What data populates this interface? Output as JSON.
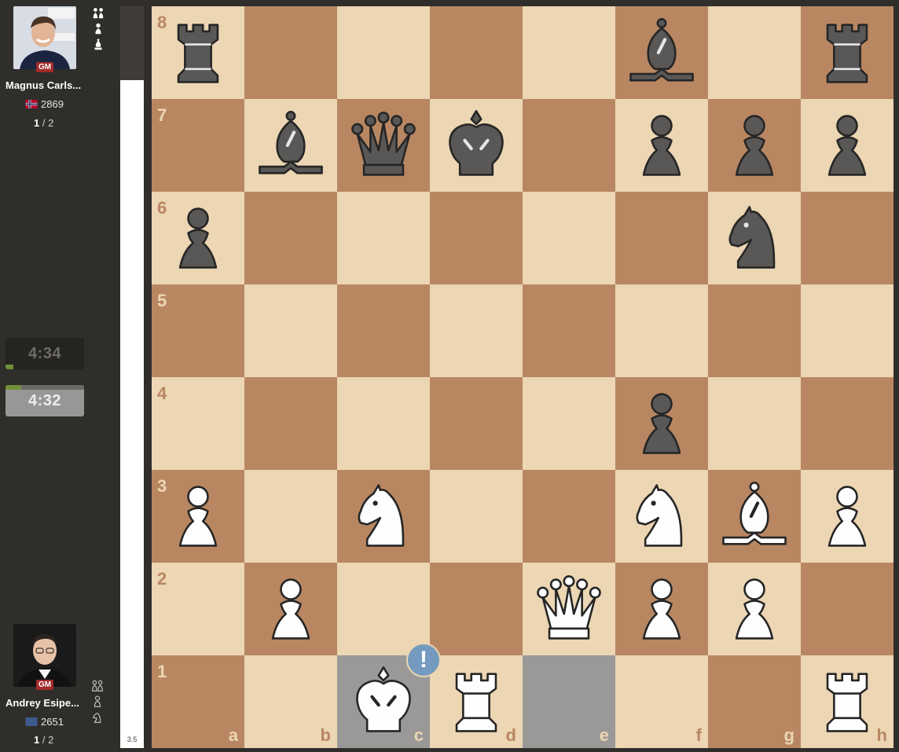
{
  "top_player": {
    "title": "GM",
    "name": "Magnus Carls...",
    "rating": "2869",
    "flag": "norway",
    "score_bold": "1",
    "score_rest": "/ 2",
    "captured_icons": [
      "two-pawns-icon",
      "pawn-icon",
      "bishop-icon"
    ]
  },
  "bottom_player": {
    "title": "GM",
    "name": "Andrey Esipe...",
    "rating": "2651",
    "flag": "blue-flag",
    "score_bold": "1",
    "score_rest": "/ 2",
    "captured_icons": [
      "two-pawns-icon",
      "pawn-icon",
      "knight-icon"
    ]
  },
  "clocks": {
    "black": "4:34",
    "white": "4:32"
  },
  "eval": {
    "text": "3.5",
    "black_fraction": 0.1
  },
  "board": {
    "ranks": [
      "8",
      "7",
      "6",
      "5",
      "4",
      "3",
      "2",
      "1"
    ],
    "files": [
      "a",
      "b",
      "c",
      "d",
      "e",
      "f",
      "g",
      "h"
    ],
    "light_color": "#ecd6b3",
    "dark_color": "#b88762",
    "highlight_squares": [
      "c1",
      "e1"
    ],
    "marker": {
      "square": "c1",
      "symbol": "!"
    },
    "pieces": [
      {
        "sq": "a8",
        "p": "bR"
      },
      {
        "sq": "f8",
        "p": "bB"
      },
      {
        "sq": "h8",
        "p": "bR"
      },
      {
        "sq": "b7",
        "p": "bB"
      },
      {
        "sq": "c7",
        "p": "bQ"
      },
      {
        "sq": "d7",
        "p": "bK"
      },
      {
        "sq": "f7",
        "p": "bP"
      },
      {
        "sq": "g7",
        "p": "bP"
      },
      {
        "sq": "h7",
        "p": "bP"
      },
      {
        "sq": "a6",
        "p": "bP"
      },
      {
        "sq": "g6",
        "p": "bN"
      },
      {
        "sq": "f4",
        "p": "bP"
      },
      {
        "sq": "a3",
        "p": "wP"
      },
      {
        "sq": "c3",
        "p": "wN"
      },
      {
        "sq": "f3",
        "p": "wN"
      },
      {
        "sq": "g3",
        "p": "wB"
      },
      {
        "sq": "h3",
        "p": "wP"
      },
      {
        "sq": "b2",
        "p": "wP"
      },
      {
        "sq": "e2",
        "p": "wQ"
      },
      {
        "sq": "f2",
        "p": "wP"
      },
      {
        "sq": "g2",
        "p": "wP"
      },
      {
        "sq": "c1",
        "p": "wK"
      },
      {
        "sq": "d1",
        "p": "wR"
      },
      {
        "sq": "h1",
        "p": "wR"
      }
    ]
  }
}
